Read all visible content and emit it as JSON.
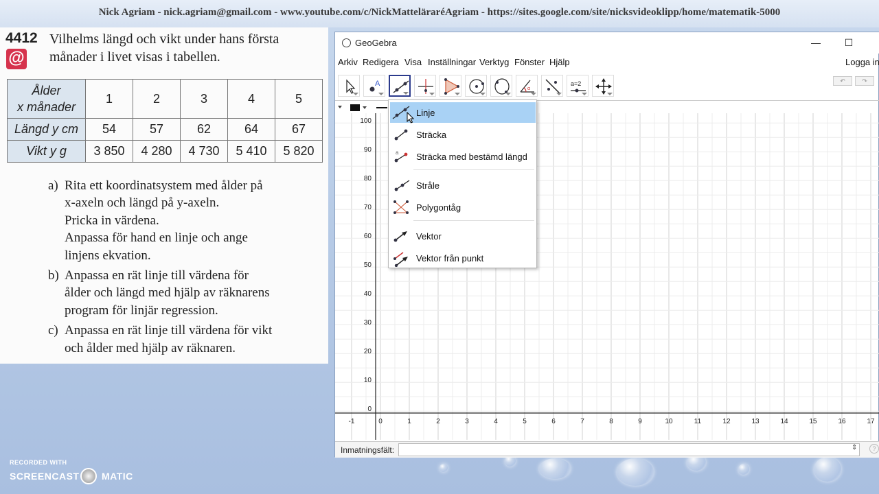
{
  "banner": {
    "text": "Nick Agriam - nick.agriam@gmail.com - www.youtube.com/c/NickMatteläraréAgriam - https://sites.google.com/site/nicksvideoklipp/home/matematik-5000"
  },
  "textbook": {
    "exercise_number": "4412",
    "exercise_mark": "@",
    "title_lines": [
      "Vilhelms längd och vikt under hans första",
      "månader i livet visas i tabellen."
    ],
    "table": {
      "header_label": [
        "Ålder",
        "x månader"
      ],
      "ages": [
        "1",
        "2",
        "3",
        "4",
        "5"
      ],
      "rows": [
        {
          "label": "Längd y cm",
          "values": [
            "54",
            "57",
            "62",
            "64",
            "67"
          ]
        },
        {
          "label": "Vikt y g",
          "values": [
            "3 850",
            "4 280",
            "4 730",
            "5 410",
            "5 820"
          ]
        }
      ]
    },
    "tasks": [
      {
        "label": "a)",
        "lines": [
          "Rita ett koordinatsystem med ålder på",
          "x-axeln och längd på y-axeln.",
          "Pricka in värdena.",
          "Anpassa för hand en linje och ange",
          "linjens ekvation."
        ]
      },
      {
        "label": "b)",
        "lines": [
          "Anpassa en rät linje till värdena för",
          "ålder och längd med hjälp av räknarens",
          "program för linjär regression."
        ]
      },
      {
        "label": "c)",
        "lines": [
          "Anpassa en rät linje till värdena för vikt",
          "och ålder med hjälp av räknaren."
        ]
      }
    ]
  },
  "geogebra": {
    "title": "GeoGebra",
    "window_buttons": {
      "minimize": "—",
      "maximize": "☐"
    },
    "menu": [
      "Arkiv",
      "Redigera",
      "Visa",
      "Inställningar",
      "Verktyg",
      "Fönster",
      "Hjälp"
    ],
    "login": "Logga in",
    "tools": [
      "move-tool",
      "point-tool",
      "line-tool",
      "perpendicular-tool",
      "polygon-tool",
      "circle-tool",
      "circle-through-points-tool",
      "angle-tool",
      "reflect-tool",
      "slider-tool",
      "move-view-tool"
    ],
    "slider_tool_text": "a=2",
    "dropdown": [
      {
        "label": "Linje",
        "icon": "line-icon"
      },
      {
        "label": "Sträcka",
        "icon": "segment-icon"
      },
      {
        "label": "Sträcka med bestämd längd",
        "icon": "segment-fixed-length-icon"
      },
      {
        "label": "Stråle",
        "icon": "ray-icon"
      },
      {
        "label": "Polygontåg",
        "icon": "polyline-icon"
      },
      {
        "label": "Vektor",
        "icon": "vector-icon"
      },
      {
        "label": "Vektor från punkt",
        "icon": "vector-from-point-icon"
      }
    ],
    "graphics": {
      "x_ticks": [
        "-1",
        "0",
        "1",
        "2",
        "3",
        "4",
        "5",
        "6",
        "7",
        "8",
        "9",
        "10",
        "11",
        "12",
        "13",
        "14",
        "15",
        "16",
        "17"
      ],
      "y_ticks": [
        "0",
        "10",
        "20",
        "30",
        "40",
        "50",
        "60",
        "70",
        "80",
        "90",
        "100"
      ]
    },
    "input_label": "Inmatningsfält:",
    "input_value": "",
    "input_help": "?"
  },
  "watermark": {
    "line1": "RECORDED WITH",
    "left": "SCREENCAST",
    "right": "MATIC"
  },
  "colors": {
    "highlight": "#a9d2f5",
    "active_tool": "#2b3a8c",
    "exercise_mark": "#d6334d",
    "table_header": "#dbe5ef"
  }
}
